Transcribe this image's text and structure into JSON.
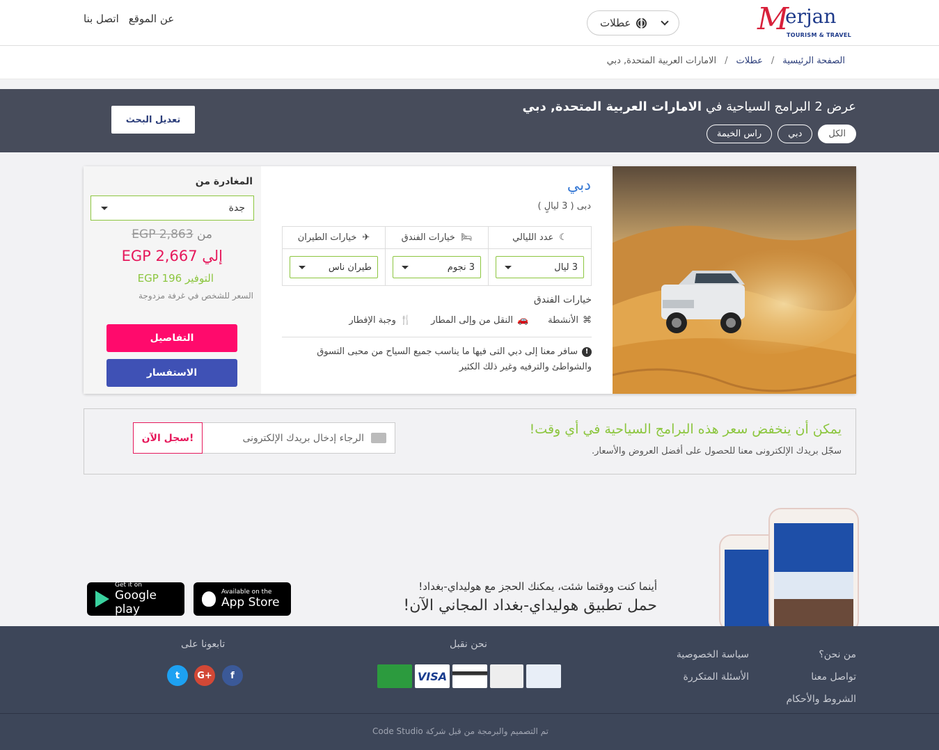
{
  "header": {
    "logo_initial": "M",
    "logo_rest": "erjan",
    "logo_tagline": "TOURISM & TRAVEL",
    "holidays_label": "عطلات",
    "top_links": [
      "عن الموقع",
      "اتصل بنا"
    ]
  },
  "breadcrumb": {
    "home": "الصفحة الرئيسية",
    "holidays": "عطلات",
    "current": "الامارات العربية المتحدة, دبي"
  },
  "summary": {
    "prefix": "عرض 2 البرامج السياحية في",
    "destination": "الامارات العربية المتحدة, دبي",
    "filters": [
      "الكل",
      "دبي",
      "راس الخيمة"
    ],
    "active_filter": "الكل",
    "modify_button": "تعديل البحث"
  },
  "package": {
    "title": "دبي",
    "subtitle": "دبى ( 3 ليالٍ )",
    "options": {
      "nights_header": "عدد الليالي",
      "nights_value": "3 ليال",
      "hotel_header": "خيارات الفندق",
      "hotel_value": "3 نجوم",
      "flight_header": "خيارات الطيران",
      "flight_value": "طيران ناس"
    },
    "hotel_options_label": "خيارات الفندق",
    "features": [
      "الأنشطة",
      "النقل من وإلى المطار",
      "وجبة الإفطار"
    ],
    "description": "سافر معنا إلى دبي التى فيها ما يناسب جميع السياح من محبى التسوق والشواطئ والترفيه وغير ذلك الكثير",
    "departure_label": "المغادرة من",
    "departure_value": "جدة",
    "price_from_label": "من",
    "price_old": "EGP 2,863",
    "price_to_label": "إلي",
    "price_new": "EGP 2,667",
    "saving_label": "التوفير",
    "saving_value": "EGP 196",
    "per_person": "السعر للشخص في غرفة مزدوجة",
    "details_button": "التفاصيل",
    "inquiry_button": "الاستفسار"
  },
  "alert": {
    "title": "يمكن أن ينخفض سعر هذه البرامج السياحية في أي وقت!",
    "subtitle": "سجّل بريدك الإلكترونى معنا للحصول على أفضل العروض والأسعار.",
    "email_placeholder": "الرجاء إدخال بريدك الإلكترونى",
    "signup_button": "سجل الآن!"
  },
  "app": {
    "subtitle": "أينما كنت ووقتما شئت، يمكنك الحجز مع هوليداي-بغداد!",
    "title": "حمل تطبيق هوليداي-بغداد المجاني الآن!",
    "google_small": "Get it on",
    "google_big": "Google play",
    "apple_small": "Available on the",
    "apple_big": "App Store"
  },
  "footer": {
    "col1": [
      "من نحن؟",
      "تواصل معنا",
      "الشروط والأحكام"
    ],
    "col2": [
      "سياسة الخصوصية",
      "الأسئلة المتكررة"
    ],
    "we_accept": "نحن نقبل",
    "visa": "VISA",
    "follow_us": "تابعونا على",
    "copyright": "تم التصميم والبرمجة من قبل شركة Code Studio"
  },
  "colors": {
    "accent_pink": "#ff0a6c",
    "accent_blue": "#3f51b5",
    "accent_green": "#8cc63f",
    "summary_bg": "#474c5b",
    "footer_bg": "#3d4659"
  }
}
